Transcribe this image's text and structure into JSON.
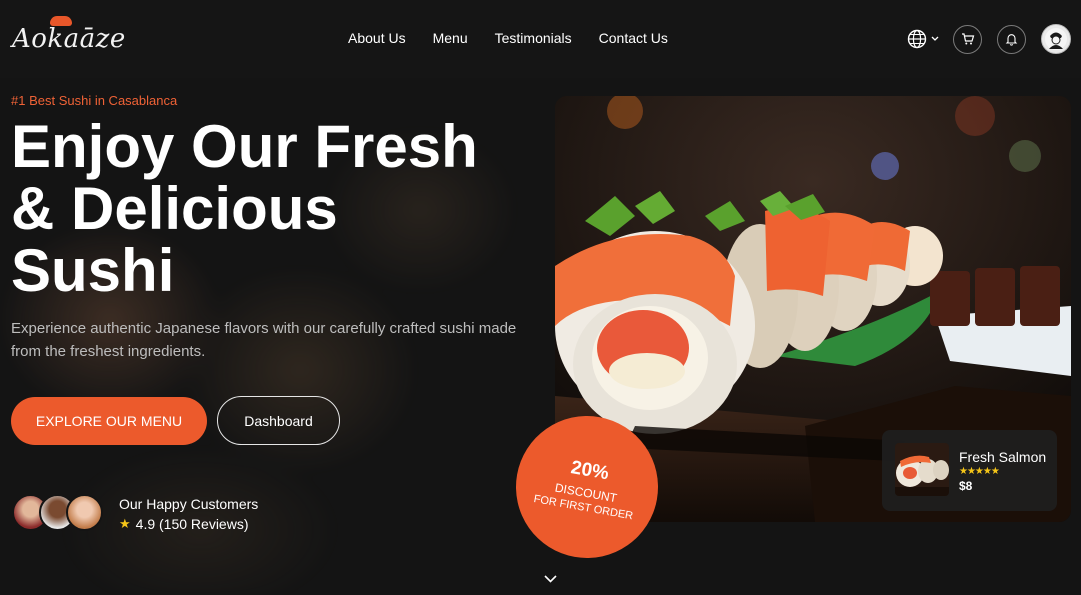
{
  "brand": {
    "name": "Aokaāze"
  },
  "nav": {
    "items": [
      "About Us",
      "Menu",
      "Testimonials",
      "Contact Us"
    ]
  },
  "header_actions": {
    "icons": [
      "globe-icon",
      "chevron-down-icon",
      "cart-icon",
      "bell-icon",
      "user-avatar"
    ]
  },
  "hero": {
    "tagline": "#1 Best Sushi in Casablanca",
    "title_line1": "Enjoy Our Fresh",
    "title_line2": "& Delicious",
    "title_line3": "Sushi",
    "subtitle": "Experience authentic Japanese flavors with our carefully crafted sushi made from the freshest ingredients.",
    "primary_cta": "EXPLORE OUR MENU",
    "secondary_cta": "Dashboard"
  },
  "customers": {
    "title": "Our Happy Customers",
    "rating": "4.9 (150 Reviews)"
  },
  "discount": {
    "percent": "20%",
    "line1": "DISCOUNT",
    "line2": "FOR FIRST ORDER"
  },
  "product": {
    "name": "Fresh Salmon",
    "stars": "★★★★★",
    "price": "$8"
  },
  "colors": {
    "accent": "#ec5a2c",
    "background": "#141414",
    "star": "#f5c518"
  }
}
